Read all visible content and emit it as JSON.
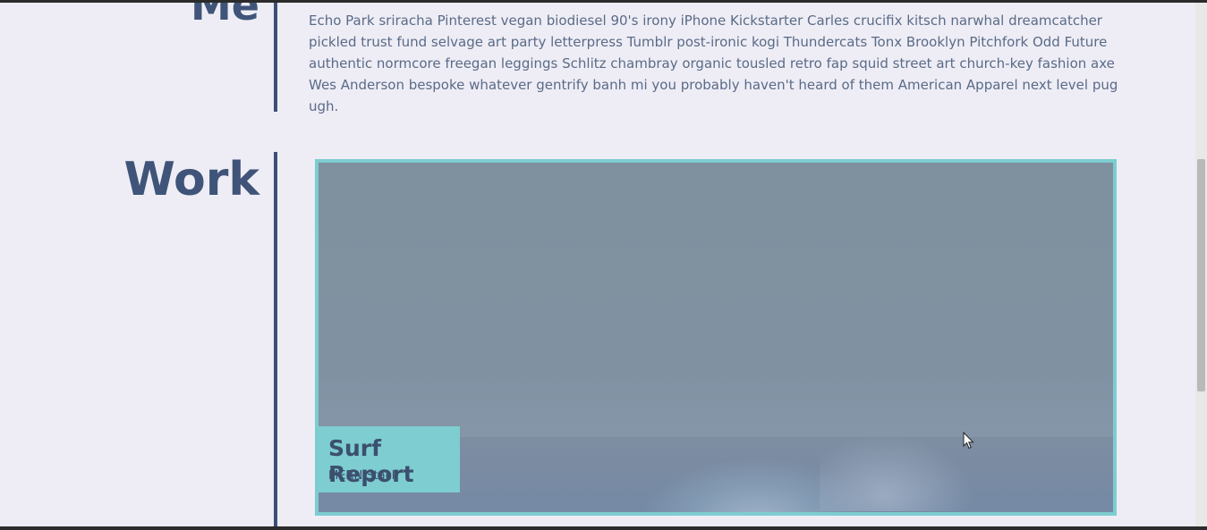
{
  "about": {
    "heading": "Me",
    "paragraph": "Echo Park sriracha Pinterest vegan biodiesel 90's irony iPhone Kickstarter Carles crucifix kitsch narwhal dreamcatcher pickled trust fund selvage art party letterpress Tumblr post-ironic kogi Thundercats Tonx Brooklyn Pitchfork Odd Future authentic normcore freegan leggings Schlitz chambray organic tousled retro fap squid street art church-key fashion axe Wes Anderson bespoke whatever gentrify banh mi you probably haven't heard of them American Apparel next level pug ugh."
  },
  "work": {
    "heading": "Work",
    "projects": [
      {
        "title": "Surf Report",
        "subtitle": "MERN Stack"
      }
    ]
  },
  "colors": {
    "background": "#eeedf6",
    "heading": "#3f5478",
    "accent": "#7ecdd0",
    "divider": "#3c5077",
    "body_text": "#5a6b86"
  },
  "icons": {
    "cursor": "mouse-pointer-icon"
  }
}
